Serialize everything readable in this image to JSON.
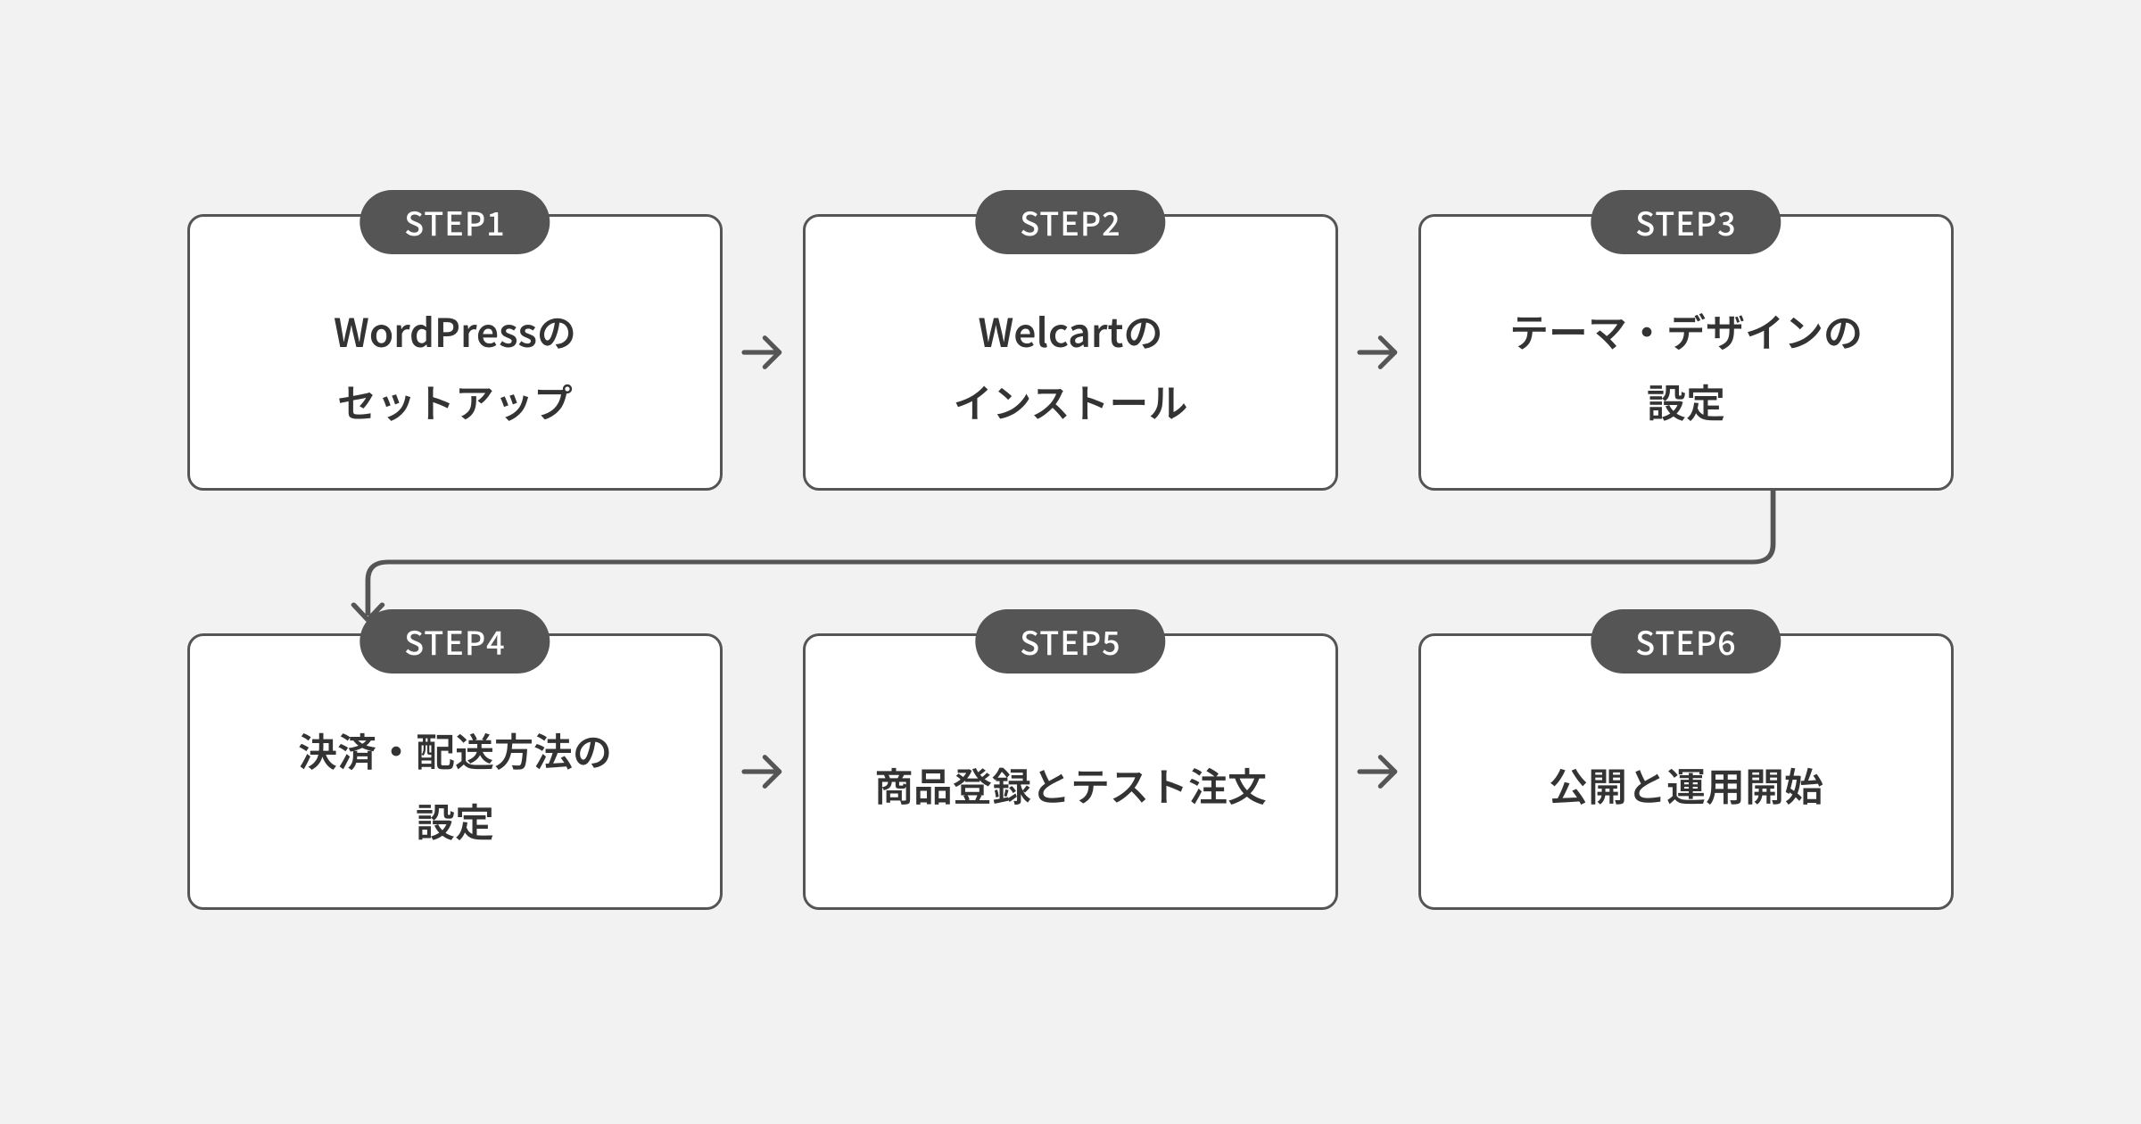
{
  "steps": [
    {
      "badge": "STEP1",
      "title": "WordPressの\nセットアップ"
    },
    {
      "badge": "STEP2",
      "title": "Welcartの\nインストール"
    },
    {
      "badge": "STEP3",
      "title": "テーマ・デザインの\n設定"
    },
    {
      "badge": "STEP4",
      "title": "決済・配送方法の\n設定"
    },
    {
      "badge": "STEP5",
      "title": "商品登録とテスト注文"
    },
    {
      "badge": "STEP6",
      "title": "公開と運用開始"
    }
  ],
  "colors": {
    "background": "#f2f2f2",
    "card_bg": "#ffffff",
    "border": "#555555",
    "badge_bg": "#555555",
    "badge_text": "#ffffff",
    "title_text": "#333333",
    "arrow": "#555555"
  }
}
